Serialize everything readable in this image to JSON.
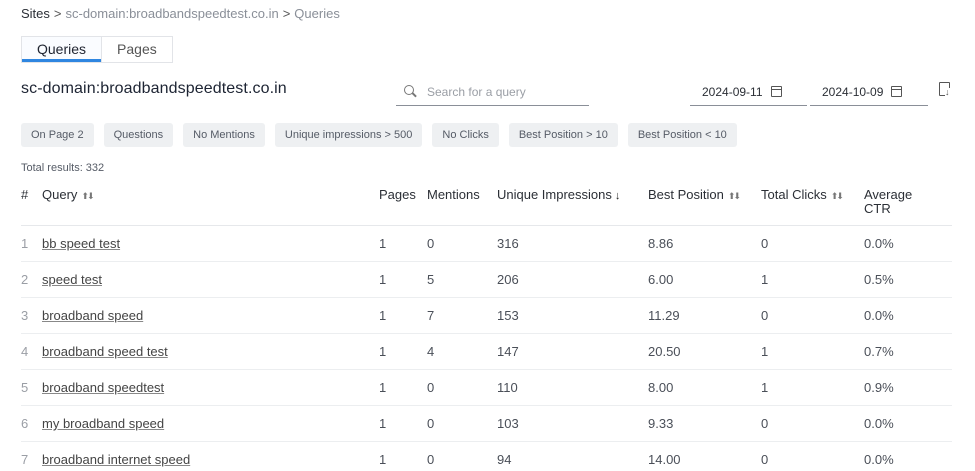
{
  "breadcrumb": {
    "root": "Sites",
    "site": "sc-domain:broadbandspeedtest.co.in",
    "current": "Queries",
    "separator": ">"
  },
  "tabs": [
    {
      "label": "Queries",
      "active": true
    },
    {
      "label": "Pages",
      "active": false
    }
  ],
  "site_title": "sc-domain:broadbandspeedtest.co.in",
  "search": {
    "placeholder": "Search for a query",
    "value": ""
  },
  "date_range": {
    "start": "2024-09-11",
    "end": "2024-10-09"
  },
  "filters": [
    "On Page 2",
    "Questions",
    "No Mentions",
    "Unique impressions > 500",
    "No Clicks",
    "Best Position > 10",
    "Best Position < 10"
  ],
  "total_results": "Total results: 332",
  "table": {
    "headers": {
      "index": "#",
      "query": "Query",
      "pages": "Pages",
      "mentions": "Mentions",
      "unique_impressions": "Unique Impressions",
      "best_position": "Best Position",
      "total_clicks": "Total Clicks",
      "average_ctr_line1": "Average",
      "average_ctr_line2": "CTR"
    },
    "rows": [
      {
        "index": "1",
        "query": "bb speed test",
        "pages": "1",
        "mentions": "0",
        "unique_impressions": "316",
        "best_position": "8.86",
        "total_clicks": "0",
        "average_ctr": "0.0%"
      },
      {
        "index": "2",
        "query": "speed test",
        "pages": "1",
        "mentions": "5",
        "unique_impressions": "206",
        "best_position": "6.00",
        "total_clicks": "1",
        "average_ctr": "0.5%"
      },
      {
        "index": "3",
        "query": "broadband speed",
        "pages": "1",
        "mentions": "7",
        "unique_impressions": "153",
        "best_position": "11.29",
        "total_clicks": "0",
        "average_ctr": "0.0%"
      },
      {
        "index": "4",
        "query": "broadband speed test",
        "pages": "1",
        "mentions": "4",
        "unique_impressions": "147",
        "best_position": "20.50",
        "total_clicks": "1",
        "average_ctr": "0.7%"
      },
      {
        "index": "5",
        "query": "broadband speedtest",
        "pages": "1",
        "mentions": "0",
        "unique_impressions": "110",
        "best_position": "8.00",
        "total_clicks": "1",
        "average_ctr": "0.9%"
      },
      {
        "index": "6",
        "query": "my broadband speed",
        "pages": "1",
        "mentions": "0",
        "unique_impressions": "103",
        "best_position": "9.33",
        "total_clicks": "0",
        "average_ctr": "0.0%"
      },
      {
        "index": "7",
        "query": "broadband internet speed",
        "pages": "1",
        "mentions": "0",
        "unique_impressions": "94",
        "best_position": "14.00",
        "total_clicks": "0",
        "average_ctr": "0.0%"
      }
    ]
  },
  "colors": {
    "accent": "#2f86e0",
    "chip_bg": "#eef0f2"
  },
  "icons": [
    "search-icon",
    "calendar-icon",
    "export-icon",
    "sort-icon",
    "sort-desc-icon"
  ]
}
